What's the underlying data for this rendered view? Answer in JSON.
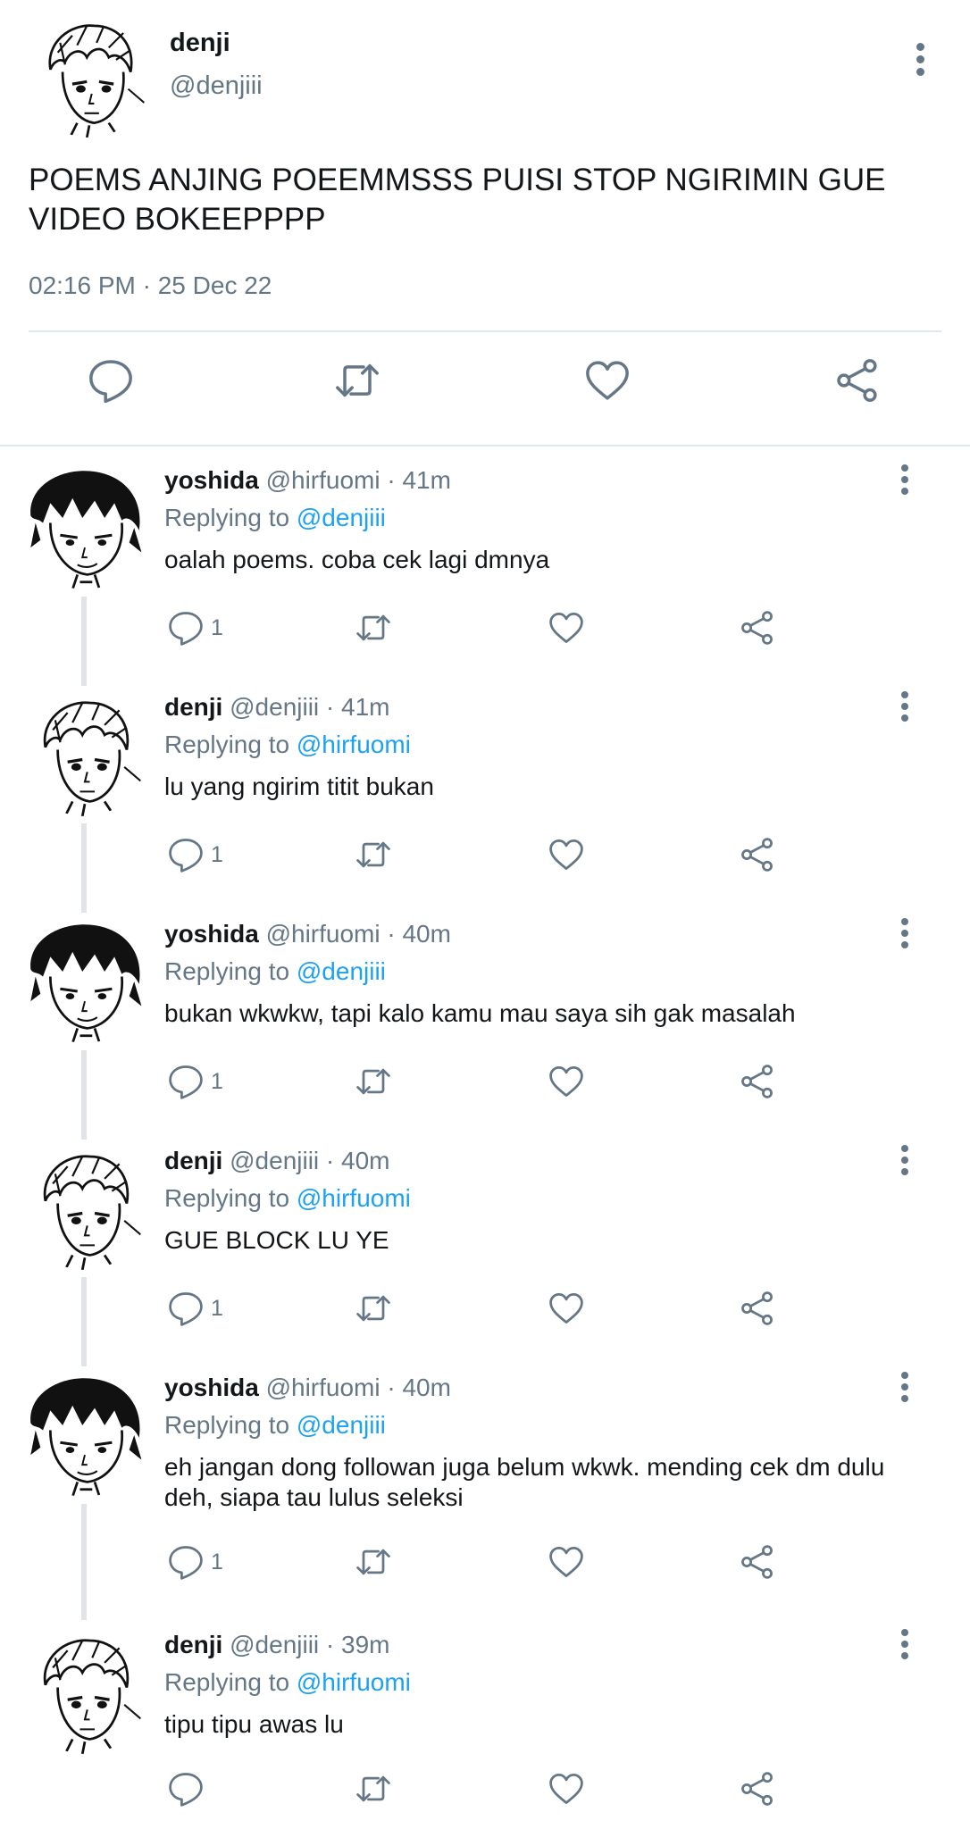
{
  "main_tweet": {
    "name": "denji",
    "handle": "@denjiii",
    "text": "POEMS ANJING POEEMMSSS  PUISI STOP NGIRIMIN GUE VIDEO BOKEEPPPP",
    "timestamp": "02:16 PM · 25 Dec 22",
    "icons": [
      "comment-icon",
      "retweet-icon",
      "like-icon",
      "share-icon",
      "more-icon"
    ]
  },
  "replies": [
    {
      "name": "yoshida",
      "handle": "@hirfuomi · 41m",
      "replying_prefix": "Replying to ",
      "replying_to": "@denjiii",
      "text": "oalah poems. coba cek lagi dmnya",
      "comment_count": "1"
    },
    {
      "name": "denji",
      "handle": "@denjiii · 41m",
      "replying_prefix": "Replying to ",
      "replying_to": "@hirfuomi",
      "text": "lu yang ngirim titit bukan",
      "comment_count": "1"
    },
    {
      "name": "yoshida",
      "handle": "@hirfuomi · 40m",
      "replying_prefix": "Replying to ",
      "replying_to": "@denjiii",
      "text": "bukan wkwkw, tapi kalo kamu mau saya sih gak masalah",
      "comment_count": "1"
    },
    {
      "name": "denji",
      "handle": "@denjiii · 40m",
      "replying_prefix": "Replying to ",
      "replying_to": "@hirfuomi",
      "text": "GUE BLOCK LU YE",
      "comment_count": "1"
    },
    {
      "name": "yoshida",
      "handle": "@hirfuomi · 40m",
      "replying_prefix": "Replying to ",
      "replying_to": "@denjiii",
      "text": "eh jangan dong followan juga belum wkwk. mending cek dm dulu deh, siapa tau lulus seleksi",
      "comment_count": "1"
    },
    {
      "name": "denji",
      "handle": "@denjiii · 39m",
      "replying_prefix": "Replying to ",
      "replying_to": "@hirfuomi",
      "text": "tipu tipu awas lu",
      "comment_count": ""
    }
  ],
  "colors": {
    "text": "#14171a",
    "secondary": "#657786",
    "link": "#1da1f2",
    "divider": "#e1e8ed"
  }
}
